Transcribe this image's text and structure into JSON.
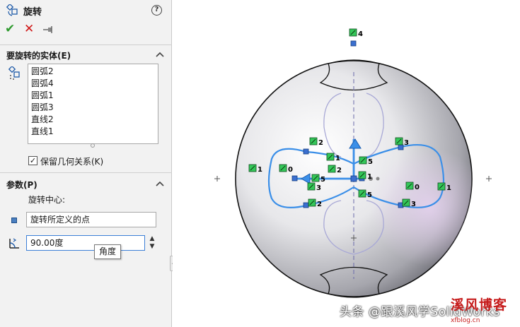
{
  "panel": {
    "title": "旋转",
    "help_label": "?",
    "actions": {
      "ok_glyph": "✔",
      "cancel_glyph": "✕"
    },
    "entities_section": {
      "header": "要旋转的实体(E)",
      "items": [
        "圆弧2",
        "圆弧4",
        "圆弧1",
        "圆弧3",
        "直线2",
        "直线1"
      ]
    },
    "keep_relations": {
      "checked": true,
      "check_glyph": "✓",
      "label": "保留几何关系(K)"
    },
    "params_section": {
      "header": "参数(P)",
      "center_label": "旋转中心:",
      "center_value": "旋转所定义的点",
      "angle_value": "90.00度",
      "spin_up": "▲",
      "spin_down": "▼",
      "angle_tooltip": "角度"
    },
    "flyout_glyph": "◂"
  },
  "viewport": {
    "relations": [
      {
        "label": "4"
      },
      {
        "label": "2"
      },
      {
        "label": "1"
      },
      {
        "label": "0"
      },
      {
        "label": "5"
      },
      {
        "label": "1"
      },
      {
        "label": "2"
      },
      {
        "label": "5"
      },
      {
        "label": "3"
      },
      {
        "label": "1"
      },
      {
        "label": "3"
      },
      {
        "label": "0"
      },
      {
        "label": "1"
      },
      {
        "label": "2"
      },
      {
        "label": "3"
      },
      {
        "label": "5"
      }
    ]
  },
  "watermark": "头条 @跟溪风学SolidWorks",
  "logo": {
    "brand": "溪风博客",
    "url": "xfblog.cn"
  },
  "colors": {
    "sketch": "#3b8fe8",
    "relation_green": "#34c759",
    "accent_red": "#c61c1c"
  }
}
